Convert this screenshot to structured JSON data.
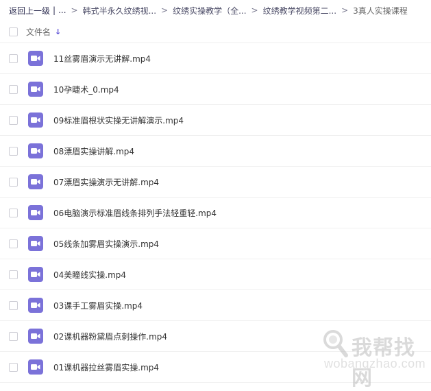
{
  "breadcrumb": {
    "back_label": "返回上一级",
    "divider": "|",
    "ellipsis": "...",
    "separator": ">",
    "items": [
      "韩式半永久纹绣视...",
      "纹绣实操教学（全...",
      "纹绣教学视频第二...",
      "3真人实操课程"
    ]
  },
  "table": {
    "column_filename": "文件名",
    "sort_indicator": "↓"
  },
  "files": [
    "11丝雾眉演示无讲解.mp4",
    "10孕睫术_0.mp4",
    "09标准眉根状实操无讲解演示.mp4",
    "08漂眉实操讲解.mp4",
    "07漂眉实操演示无讲解.mp4",
    "06电脑演示标准眉线条排列手法轻重轻.mp4",
    "05线条加雾眉实操演示.mp4",
    "04美瞳线实操.mp4",
    "03课手工雾眉实操.mp4",
    "02课机器粉黛眉点刺操作.mp4",
    "01课机器拉丝雾眉实操.mp4"
  ],
  "icons": {
    "file_type": "video-file-icon",
    "watermark": "magnifier-icon"
  },
  "colors": {
    "accent": "#5a4fd6",
    "file_icon": "#7b72d9"
  },
  "watermark": {
    "title": "我帮找网",
    "url": "wobangzhao.com"
  }
}
